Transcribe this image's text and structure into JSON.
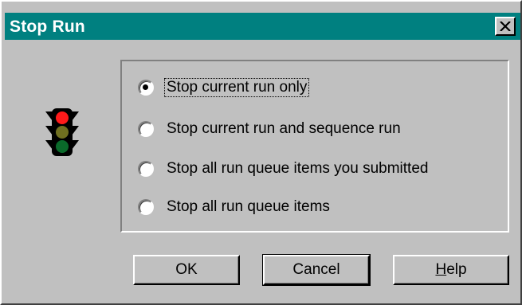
{
  "window": {
    "title": "Stop Run",
    "close_glyph": "✕"
  },
  "icon": {
    "name": "traffic-light-icon",
    "lit_color": "#ff0000"
  },
  "options": [
    {
      "label": "Stop current run only",
      "checked": true
    },
    {
      "label": "Stop current run and sequence run",
      "checked": false
    },
    {
      "label": "Stop all run queue items you submitted",
      "checked": false
    },
    {
      "label": "Stop all run queue items",
      "checked": false
    }
  ],
  "buttons": {
    "ok": "OK",
    "cancel": "Cancel",
    "help_mnemonic": "H",
    "help_rest": "elp"
  },
  "colors": {
    "titlebar": "#008080",
    "face": "#c0c0c0"
  }
}
